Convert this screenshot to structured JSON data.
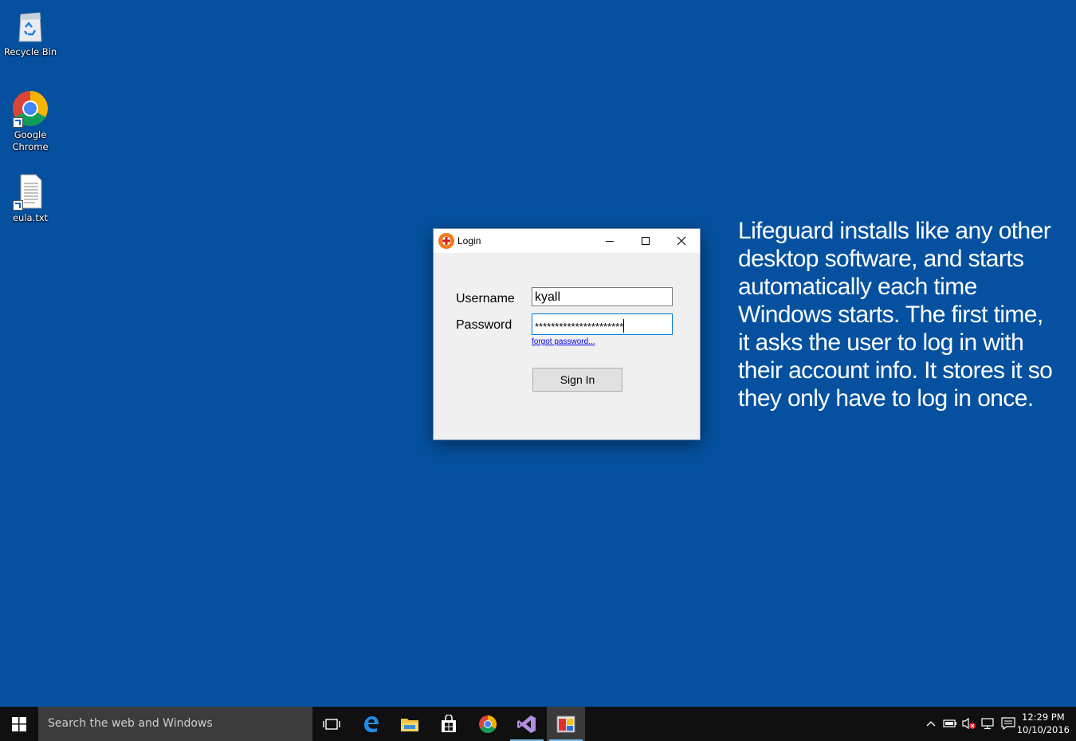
{
  "desktop": {
    "icons": [
      {
        "label": "Recycle Bin",
        "icon": "recycle-bin-icon"
      },
      {
        "label": "Google Chrome",
        "icon": "chrome-icon"
      },
      {
        "label": "eula.txt",
        "icon": "text-file-icon"
      }
    ],
    "background_color": "#0551a0"
  },
  "login_window": {
    "title": "Login",
    "icon": "lifeguard-icon",
    "username_label": "Username",
    "username_value": "kyall",
    "password_label": "Password",
    "password_value": "**********************",
    "forgot_link": "forgot password...",
    "sign_in_label": "Sign In"
  },
  "caption": {
    "text": "Lifeguard installs like any other desktop software, and starts automatically each time Windows starts. The first time, it asks the user to log in with their account info. It stores it so they only have to log in once."
  },
  "taskbar": {
    "search_placeholder": "Search the web and Windows",
    "apps": [
      "task-view-icon",
      "edge-icon",
      "file-explorer-icon",
      "store-icon",
      "chrome-icon",
      "visual-studio-icon",
      "lifeguard-app-icon"
    ],
    "clock_time": "12:29 PM",
    "clock_date": "10/10/2016"
  }
}
